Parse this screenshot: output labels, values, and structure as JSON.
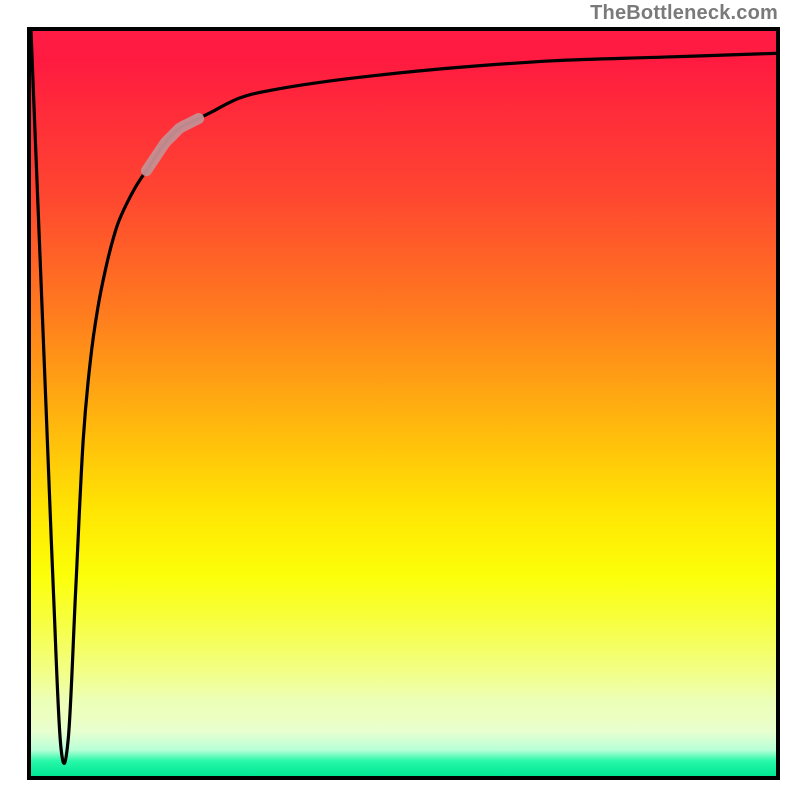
{
  "watermark": "TheBottleneck.com",
  "colors": {
    "border": "#000000",
    "curve_main": "#000000",
    "curve_accent": "#c68f93",
    "gradient_top": "#ff1b44",
    "gradient_bottom": "#00e793",
    "watermark": "#7a7a7a"
  },
  "chart_data": {
    "type": "line",
    "title": "",
    "xlabel": "",
    "ylabel": "",
    "xlim": [
      0,
      100
    ],
    "ylim": [
      0,
      100
    ],
    "legend": false,
    "grid": false,
    "series": [
      {
        "name": "bottleneck-curve",
        "x": [
          0,
          1,
          2,
          3,
          4,
          5,
          6,
          7,
          8,
          9,
          10,
          11,
          12,
          14,
          16,
          18,
          20,
          22,
          24,
          28,
          32,
          38,
          46,
          56,
          70,
          85,
          100
        ],
        "values": [
          100,
          75,
          50,
          25,
          4,
          5,
          25,
          45,
          56,
          63,
          68,
          72,
          75,
          79,
          82,
          85,
          87,
          88,
          89,
          91,
          92,
          93,
          94,
          95,
          96,
          96.5,
          97
        ]
      }
    ],
    "annotations": [
      {
        "name": "accent-segment",
        "description": "pale rosy highlighted segment on the ascending curve",
        "x_range": [
          15.5,
          22.5
        ],
        "approx_y_range": [
          81,
          89
        ]
      }
    ]
  }
}
